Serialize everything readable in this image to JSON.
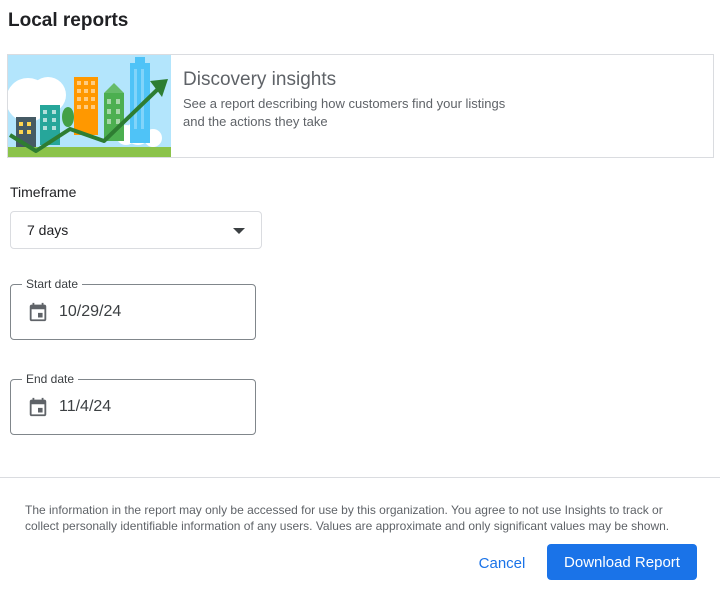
{
  "page": {
    "title": "Local reports"
  },
  "banner": {
    "image_icon": "discovery-insights-illustration",
    "title": "Discovery insights",
    "description": "See a report describing how customers find your listings and the actions they take"
  },
  "timeframe": {
    "label": "Timeframe",
    "selected": "7 days",
    "icon": "dropdown-arrow-icon"
  },
  "start_date": {
    "label": "Start date",
    "value": "10/29/24",
    "icon": "calendar-icon"
  },
  "end_date": {
    "label": "End date",
    "value": "11/4/24",
    "icon": "calendar-icon"
  },
  "disclaimer": "The information in the report may only be accessed for use by this organization. You agree to not use Insights to track or collect personally identifiable information of any users. Values are approximate and only significant values may be shown.",
  "actions": {
    "cancel": "Cancel",
    "download": "Download Report"
  },
  "colors": {
    "accent": "#1a73e8",
    "border": "#dadce0",
    "text_secondary": "#5f6368"
  }
}
